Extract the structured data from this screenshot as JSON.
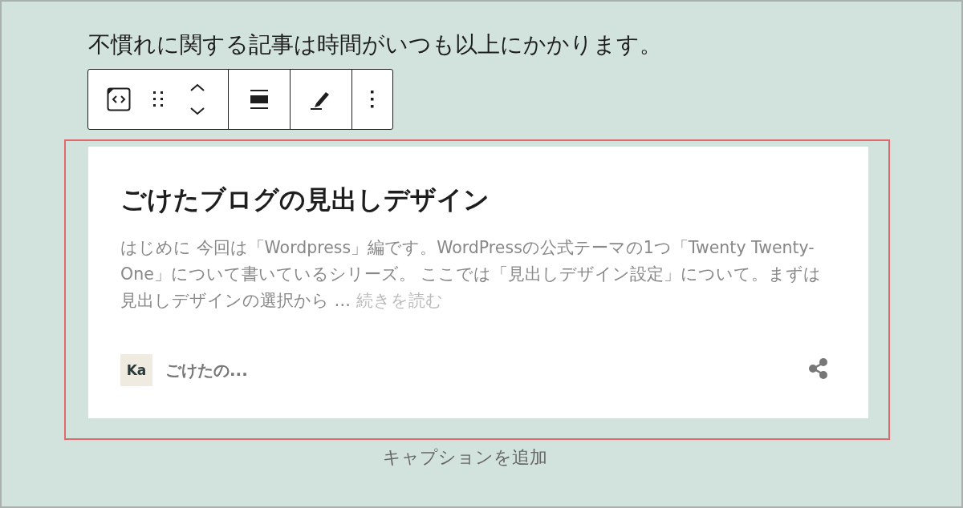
{
  "paragraph": "不慣れに関する記事は時間がいつも以上にかかります。",
  "toolbar": {
    "groups": [
      {
        "tools": [
          {
            "kind": "embed"
          },
          {
            "kind": "drag"
          },
          {
            "kind": "move"
          }
        ]
      },
      {
        "tools": [
          {
            "kind": "align"
          }
        ]
      },
      {
        "tools": [
          {
            "kind": "edit"
          }
        ]
      },
      {
        "tools": [
          {
            "kind": "more"
          }
        ]
      }
    ]
  },
  "embed": {
    "selected": true,
    "title": "ごけたブログの見出しデザイン",
    "excerpt": "はじめに 今回は「Wordpress」編です。WordPressの公式テーマの1つ「Twenty Twenty-One」について書いているシリーズ。 ここでは「見出しデザイン設定」について。まずは見出しデザインの選択から …",
    "read_more": "続きを読む",
    "site_icon": "Ka",
    "site_name": "ごけたの..."
  },
  "caption": {
    "placeholder": "キャプションを追加"
  }
}
